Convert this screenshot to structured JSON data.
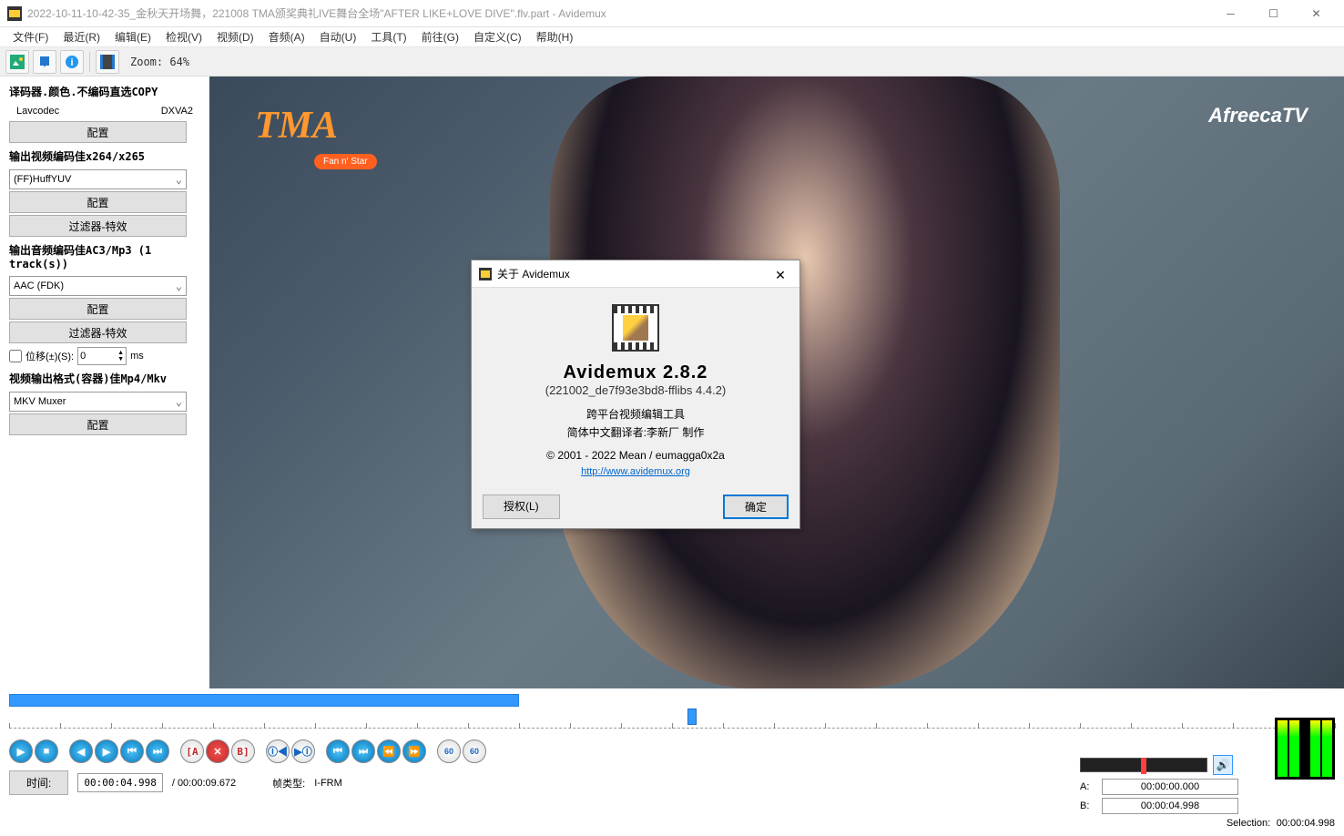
{
  "window": {
    "title": "2022-10-11-10-42-35_金秋天开场舞，221008 TMA颁奖典礼IVE舞台全场\"AFTER LIKE+LOVE DIVE\".flv.part - Avidemux"
  },
  "menu": {
    "file": "文件(F)",
    "recent": "最近(R)",
    "edit": "编辑(E)",
    "view": "检视(V)",
    "video": "视频(D)",
    "audio": "音频(A)",
    "auto": "自动(U)",
    "tools": "工具(T)",
    "goto": "前往(G)",
    "custom": "自定义(C)",
    "help": "帮助(H)"
  },
  "toolbar": {
    "zoom": "Zoom: 64%"
  },
  "sidebar": {
    "decoder": {
      "title": "译码器.颜色.不编码直选COPY",
      "codec": "Lavcodec",
      "accel": "DXVA2",
      "configure": "配置"
    },
    "videoenc": {
      "title": "输出视频编码佳x264/x265",
      "selected": "(FF)HuffYUV",
      "configure": "配置",
      "filter": "过滤器-特效"
    },
    "audioenc": {
      "title": "输出音频编码佳AC3/Mp3 (1 track(s))",
      "selected": "AAC (FDK)",
      "configure": "配置",
      "filter": "过滤器-特效",
      "shift_label": "位移(±)(S):",
      "shift_value": "0",
      "shift_unit": "ms"
    },
    "container": {
      "title": "视频输出格式(容器)佳Mp4/Mkv",
      "selected": "MKV Muxer",
      "configure": "配置"
    }
  },
  "preview": {
    "logo_left": "TMA",
    "logo_left_sub": "Fan n' Star",
    "logo_right": "AfreecaTV"
  },
  "about": {
    "title": "关于 Avidemux",
    "heading": "Avidemux 2.8.2",
    "build": "(221002_de7f93e3bd8-fflibs 4.4.2)",
    "desc": "跨平台视频编辑工具",
    "translator": "简体中文翻译者:李新厂 制作",
    "copyright": "© 2001 - 2022  Mean / eumagga0x2a",
    "url": "http://www.avidemux.org",
    "license_btn": "授权(L)",
    "ok_btn": "确定"
  },
  "bottom": {
    "time_btn": "时间:",
    "time_current": "00:00:04.998",
    "time_total": "/ 00:00:09.672",
    "frame_type_label": "帧类型:",
    "frame_type": "I-FRM",
    "a_label": "A:",
    "a_time": "00:00:00.000",
    "b_label": "B:",
    "b_time": "00:00:04.998",
    "selection_label": "Selection:",
    "selection_time": "00:00:04.998"
  }
}
